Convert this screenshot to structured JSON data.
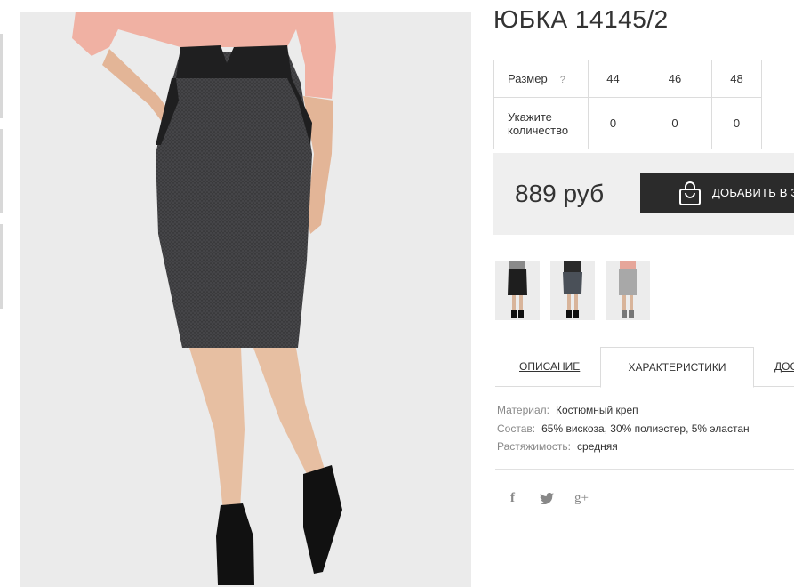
{
  "product": {
    "title": "ЮБКА 14145/2"
  },
  "sizes_table": {
    "size_label": "Размер",
    "help_icon": "question-icon",
    "help_glyph": "?",
    "sizes": [
      "44",
      "46",
      "48"
    ],
    "qty_label": "Укажите количество",
    "quantities": [
      "0",
      "0",
      "0"
    ]
  },
  "purchase": {
    "price": "889 руб",
    "add_button_label": "ДОБАВИТЬ В ЗА",
    "button_icon": "shopping-bag-icon"
  },
  "gallery": {
    "thumbnails": [
      "black-skirt-photo",
      "dark-gray-skirt-photo",
      "light-gray-skirt-photo"
    ]
  },
  "tabs": {
    "description": "ОПИСАНИЕ",
    "characteristics": "ХАРАКТЕРИСТИКИ",
    "delivery": "ДОС"
  },
  "specs": [
    {
      "key": "Материал:",
      "value": "Костюмный креп"
    },
    {
      "key": "Состав:",
      "value": "65% вискоза, 30% полиэстер, 5% эластан"
    },
    {
      "key": "Растяжимость:",
      "value": "средняя"
    }
  ],
  "share": {
    "facebook": "f",
    "twitter": "twitter-bird-icon",
    "googleplus": "g+"
  },
  "colors": {
    "button_bg": "#2b2b2b",
    "price_box_bg": "#efefef",
    "border": "#dcdcdc"
  }
}
